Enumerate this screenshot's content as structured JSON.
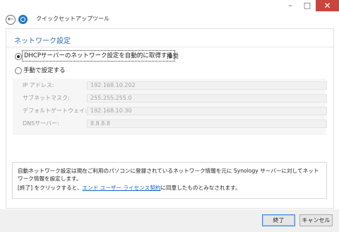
{
  "window": {
    "title": "クイックセットアップツール",
    "controls": {
      "minimize": "–",
      "maximize": "□",
      "close": "✕"
    }
  },
  "section": {
    "heading": "ネットワーク設定",
    "options": [
      {
        "label": "DHCPサーバーのネットワーク設定を自動的に取得する",
        "selected": true
      },
      {
        "label": "手動で設定する",
        "selected": false
      }
    ],
    "recommended": "推奨"
  },
  "fields": [
    {
      "label": "IP アドレス:",
      "value": "192.168.10.202"
    },
    {
      "label": "サブネットマスク:",
      "value": "255.255.255.0"
    },
    {
      "label": "デフォルトゲートウェイ:",
      "value": "192.168.10.30"
    },
    {
      "label": "DNSサーバー:",
      "value": "8.8.8.8"
    }
  ],
  "info": {
    "paragraph1": "自動ネットワーク設定は現在ご利用のパソコンに登録されているネットワーク情報を元に Synology サーバーに対してネットワーク情報を設定します。",
    "paragraph2_prefix": "[終了] をクリックすると、",
    "paragraph2_link": "エンド ユーザー ライセンス契約",
    "paragraph2_suffix": "に同意したものとみなされます。"
  },
  "footer": {
    "finish_label": "終了",
    "cancel_label": "キャンセル"
  }
}
